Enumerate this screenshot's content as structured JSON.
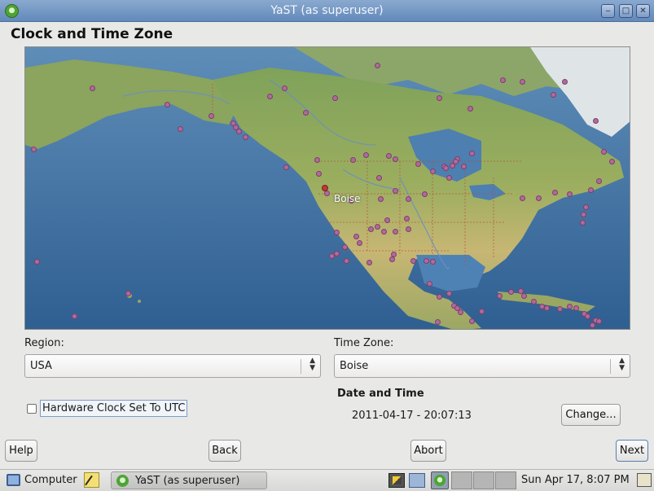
{
  "window": {
    "title": "YaST (as superuser)"
  },
  "page": {
    "title": "Clock and Time Zone"
  },
  "map": {
    "selected_city": "Boise"
  },
  "region": {
    "label": "Region:",
    "value": "USA"
  },
  "timezone": {
    "label": "Time Zone:",
    "value": "Boise"
  },
  "hwclock": {
    "label": "Hardware Clock Set To UTC",
    "checked": false
  },
  "datetime": {
    "heading": "Date and Time",
    "value": "2011-04-17 - 20:07:13",
    "change_label": "Change..."
  },
  "buttons": {
    "help": "Help",
    "back": "Back",
    "abort": "Abort",
    "next": "Next"
  },
  "taskbar": {
    "computer": "Computer",
    "task": "YaST (as superuser)",
    "clock": "Sun Apr 17,  8:07 PM"
  },
  "colors": {
    "titlebar": "#6f93c3",
    "marker": "#b06a9c",
    "selected_marker": "#c0383c",
    "ocean": "#3f6f9f"
  }
}
